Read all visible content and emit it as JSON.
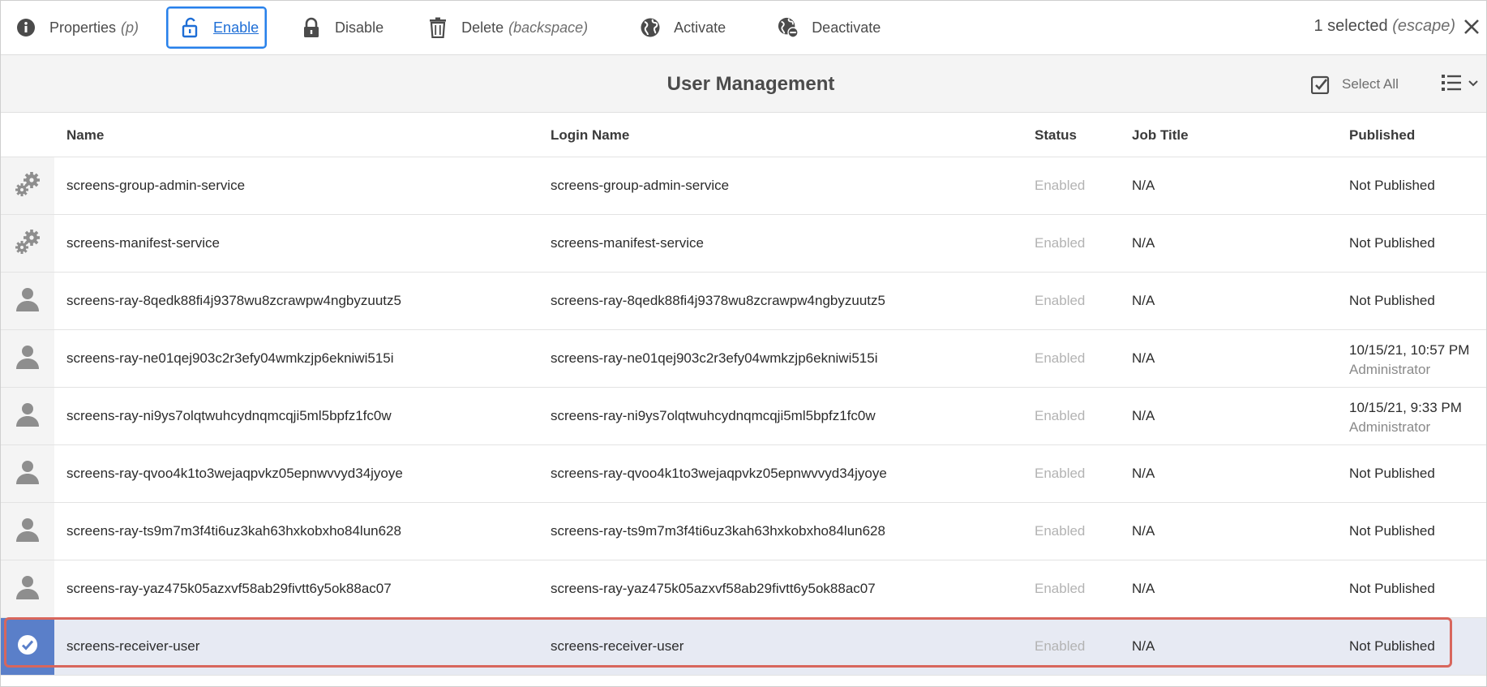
{
  "actionbar": {
    "properties": {
      "label": "Properties",
      "hint": "(p)",
      "icon": "info-icon"
    },
    "enable": {
      "label": "Enable",
      "icon": "unlock-icon"
    },
    "disable": {
      "label": "Disable",
      "icon": "lock-icon"
    },
    "delete": {
      "label": "Delete",
      "hint": "(backspace)",
      "icon": "trash-icon"
    },
    "activate": {
      "label": "Activate",
      "icon": "globe-icon"
    },
    "deactivate": {
      "label": "Deactivate",
      "icon": "globe-remove-icon"
    },
    "selection": {
      "count_text": "1 selected",
      "hint": "(escape)"
    }
  },
  "header": {
    "title": "User Management",
    "select_all": "Select All"
  },
  "table": {
    "columns": [
      "Name",
      "Login Name",
      "Status",
      "Job Title",
      "Published"
    ],
    "rows": [
      {
        "icon": "gears-icon",
        "name": "screens-group-admin-service",
        "login": "screens-group-admin-service",
        "status": "Enabled",
        "job": "N/A",
        "published": "Not Published",
        "published_by": ""
      },
      {
        "icon": "gears-icon",
        "name": "screens-manifest-service",
        "login": "screens-manifest-service",
        "status": "Enabled",
        "job": "N/A",
        "published": "Not Published",
        "published_by": ""
      },
      {
        "icon": "user-icon",
        "name": "screens-ray-8qedk88fi4j9378wu8zcrawpw4ngbyzuutz5",
        "login": "screens-ray-8qedk88fi4j9378wu8zcrawpw4ngbyzuutz5",
        "status": "Enabled",
        "job": "N/A",
        "published": "Not Published",
        "published_by": ""
      },
      {
        "icon": "user-icon",
        "name": "screens-ray-ne01qej903c2r3efy04wmkzjp6ekniwi515i",
        "login": "screens-ray-ne01qej903c2r3efy04wmkzjp6ekniwi515i",
        "status": "Enabled",
        "job": "N/A",
        "published": "10/15/21, 10:57 PM",
        "published_by": "Administrator"
      },
      {
        "icon": "user-icon",
        "name": "screens-ray-ni9ys7olqtwuhcydnqmcqji5ml5bpfz1fc0w",
        "login": "screens-ray-ni9ys7olqtwuhcydnqmcqji5ml5bpfz1fc0w",
        "status": "Enabled",
        "job": "N/A",
        "published": "10/15/21, 9:33 PM",
        "published_by": "Administrator"
      },
      {
        "icon": "user-icon",
        "name": "screens-ray-qvoo4k1to3wejaqpvkz05epnwvvyd34jyoye",
        "login": "screens-ray-qvoo4k1to3wejaqpvkz05epnwvvyd34jyoye",
        "status": "Enabled",
        "job": "N/A",
        "published": "Not Published",
        "published_by": ""
      },
      {
        "icon": "user-icon",
        "name": "screens-ray-ts9m7m3f4ti6uz3kah63hxkobxho84lun628",
        "login": "screens-ray-ts9m7m3f4ti6uz3kah63hxkobxho84lun628",
        "status": "Enabled",
        "job": "N/A",
        "published": "Not Published",
        "published_by": ""
      },
      {
        "icon": "user-icon",
        "name": "screens-ray-yaz475k05azxvf58ab29fivtt6y5ok88ac07",
        "login": "screens-ray-yaz475k05azxvf58ab29fivtt6y5ok88ac07",
        "status": "Enabled",
        "job": "N/A",
        "published": "Not Published",
        "published_by": ""
      },
      {
        "icon": "checkmark-circle-icon",
        "name": "screens-receiver-user",
        "login": "screens-receiver-user",
        "status": "Enabled",
        "job": "N/A",
        "published": "Not Published",
        "published_by": "",
        "selected": true
      }
    ]
  },
  "colors": {
    "accent": "#2680eb",
    "selected_row": "#e7eaf3",
    "selected_icon_bg": "#5a7fc9",
    "highlight_outline": "#d8665c",
    "status_text": "#b3b3b3"
  }
}
